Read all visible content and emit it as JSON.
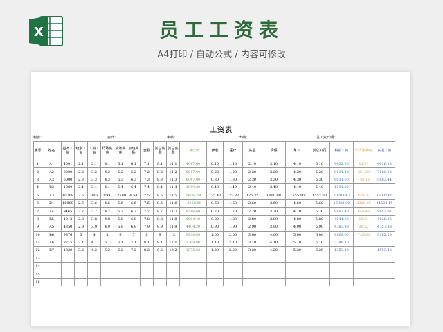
{
  "header": {
    "title": "员工工资表",
    "subtitle": "A4打印 / 自动公式 / 内容可修改",
    "logo_icon": "excel-icon",
    "logo_color": "#217346"
  },
  "sheet": {
    "title": "工资表",
    "meta": [
      "制表：",
      "会计：",
      "审核：",
      "出纳：",
      "发工资日期："
    ],
    "columns": [
      "序号",
      "姓名",
      "基本工资",
      "级别工资",
      "工龄工资",
      "行政奖金",
      "绩效奖金",
      "加班奖贴",
      "全勤",
      "其它奖励",
      "其它奖励",
      "工资小计",
      "养老",
      "医疗",
      "失业",
      "请假",
      "旷工",
      "其它扣罚",
      "税前工资",
      "个人所得税",
      "实发工资"
    ],
    "rows": [
      [
        "1",
        "A1",
        "4001",
        "2.1",
        "3.1",
        "4.1",
        "5.1",
        "6.1",
        "7.1",
        "8.1",
        "11.1",
        "4047.60",
        "0.10",
        "1.10",
        "2.10",
        "3.10",
        "4.10",
        "5.10",
        "4032.20",
        "15.97",
        "4016.23"
      ],
      [
        "2",
        "A2",
        "8000",
        "2.2",
        "3.2",
        "4.2",
        "5.2",
        "6.2",
        "7.2",
        "8.2",
        "11.2",
        "8047.00",
        "0.20",
        "1.20",
        "2.20",
        "3.20",
        "4.20",
        "5.20",
        "8031.40",
        "351.28",
        "7680.12"
      ],
      [
        "3",
        "A3",
        "6000",
        "2.3",
        "3.3",
        "4.3",
        "5.3",
        "6.3",
        "7.3",
        "8.3",
        "11.3",
        "6047.00",
        "0.30",
        "1.30",
        "2.30",
        "3.30",
        "4.30",
        "5.30",
        "6031.60",
        "146.16",
        "5883.44"
      ],
      [
        "4",
        "B3",
        "1000",
        "2.4",
        "3.4",
        "4.4",
        "5.4",
        "6.4",
        "7.4",
        "8.4",
        "11.4",
        "1049.20",
        "0.40",
        "1.40",
        "2.40",
        "3.40",
        "4.40",
        "5.40",
        "1031.80",
        "",
        ""
      ],
      [
        "5",
        "A3",
        "10208",
        "2.5",
        "300",
        "1560",
        "12580",
        "6.54",
        "7.5",
        "8.5",
        "11.5",
        "24684.54",
        "125.43",
        "123.32",
        "125.32",
        "1000.00",
        "1555.00",
        "1552.00",
        "20203.47",
        "3170.87",
        "17032.60"
      ],
      [
        "6",
        "B4",
        "16800",
        "2.6",
        "3.6",
        "4.6",
        "5.6",
        "6.6",
        "7.6",
        "8.6",
        "11.6",
        "16850.80",
        "0.60",
        "1.60",
        "2.60",
        "3.60",
        "4.60",
        "5.60",
        "16832.20",
        "2328.05",
        "14504.15"
      ],
      [
        "7",
        "A4",
        "9465",
        "2.7",
        "3.7",
        "4.7",
        "5.7",
        "6.7",
        "7.7",
        "8.7",
        "11.7",
        "9516.60",
        "0.70",
        "1.70",
        "2.70",
        "3.70",
        "4.70",
        "5.70",
        "9497.40",
        "644.48",
        "8852.92"
      ],
      [
        "8",
        "B5",
        "4012",
        "2.8",
        "3.8",
        "4.8",
        "5.8",
        "6.8",
        "7.8",
        "8.8",
        "11.8",
        "4064.40",
        "0.80",
        "1.80",
        "2.80",
        "3.80",
        "4.80",
        "5.80",
        "4044.60",
        "16.34",
        "4028.26"
      ],
      [
        "9",
        "A5",
        "4350",
        "2.9",
        "3.9",
        "4.9",
        "5.9",
        "6.9",
        "7.9",
        "8.9",
        "11.9",
        "4404.20",
        "0.90",
        "1.90",
        "2.90",
        "3.90",
        "4.90",
        "5.90",
        "4383.90",
        "26.52",
        "4357.38"
      ],
      [
        "10",
        "B6",
        "9876",
        "3",
        "4",
        "5",
        "6",
        "7",
        "8",
        "9",
        "12",
        "9930.00",
        "1.00",
        "2.00",
        "3.00",
        "4.00",
        "5.00",
        "6.00",
        "9909.00",
        "726.80",
        "9182.20"
      ],
      [
        "11",
        "A6",
        "3215",
        "3.1",
        "4.1",
        "5.1",
        "6.1",
        "7.1",
        "8.1",
        "9.1",
        "12.1",
        "3269.80",
        "1.10",
        "2.10",
        "3.10",
        "4.10",
        "5.10",
        "6.10",
        "3248.20",
        "",
        ""
      ],
      [
        "12",
        "B7",
        "1320",
        "3.2",
        "4.2",
        "5.2",
        "6.2",
        "7.2",
        "8.2",
        "9.2",
        "12.2",
        "1375.60",
        "1.20",
        "2.20",
        "3.20",
        "4.20",
        "5.20",
        "6.20",
        "1353.40",
        "",
        "1553.40"
      ],
      [
        "13",
        "",
        "",
        "",
        "",
        "",
        "",
        "",
        "",
        "",
        "",
        "",
        "",
        "",
        "",
        "",
        "",
        "",
        "",
        "",
        ""
      ],
      [
        "14",
        "",
        "",
        "",
        "",
        "",
        "",
        "",
        "",
        "",
        "",
        "",
        "",
        "",
        "",
        "",
        "",
        "",
        "",
        "",
        ""
      ],
      [
        "15",
        "",
        "",
        "",
        "",
        "",
        "",
        "",
        "",
        "",
        "",
        "",
        "",
        "",
        "",
        "",
        "",
        "",
        "",
        "",
        ""
      ],
      [
        "16",
        "",
        "",
        "",
        "",
        "",
        "",
        "",
        "",
        "",
        "",
        "",
        "",
        "",
        "",
        "",
        "",
        "",
        "",
        "",
        ""
      ]
    ]
  },
  "colors": {
    "green_text": "#5aa04a",
    "blue_text": "#2f6fb1",
    "orange_text": "#e39a4b",
    "title_green": "#2f6a3b"
  }
}
